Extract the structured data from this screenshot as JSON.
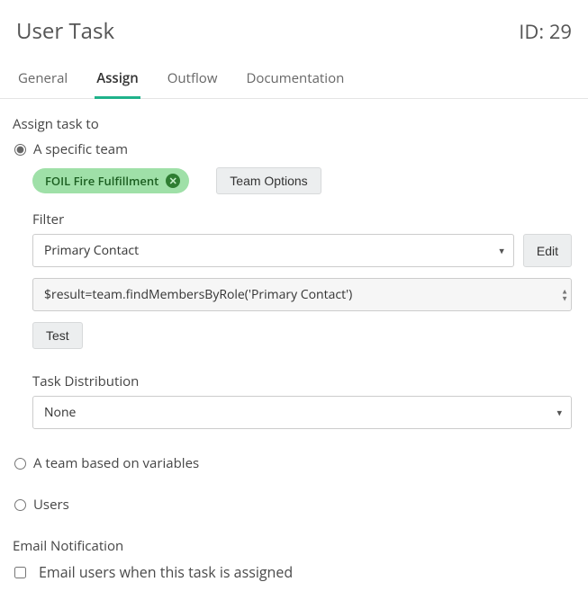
{
  "header": {
    "title": "User Task",
    "id_label": "ID: 29"
  },
  "tabs": {
    "general": "General",
    "assign": "Assign",
    "outflow": "Outflow",
    "documentation": "Documentation"
  },
  "assign": {
    "section_label": "Assign task to",
    "radio_specific": "A specific team",
    "radio_variables": "A team based on variables",
    "radio_users": "Users",
    "team_chip": "FOIL Fire Fulfillment",
    "team_options_btn": "Team Options",
    "filter_label": "Filter",
    "filter_value": "Primary Contact",
    "edit_btn": "Edit",
    "code_value": "$result=team.findMembersByRole('Primary Contact')",
    "test_btn": "Test",
    "task_dist_label": "Task Distribution",
    "task_dist_value": "None"
  },
  "email": {
    "section_label": "Email Notification",
    "checkbox_label": "Email users when this task is assigned"
  }
}
